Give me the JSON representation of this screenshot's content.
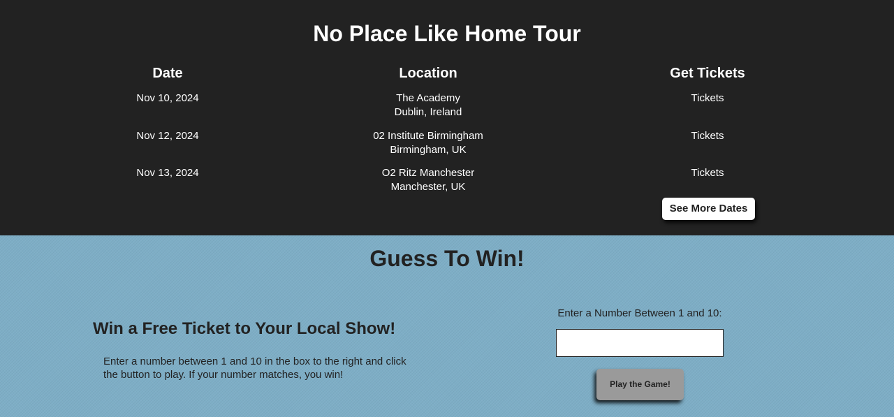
{
  "tour": {
    "title": "No Place Like Home Tour",
    "headers": {
      "date": "Date",
      "location": "Location",
      "tickets": "Get Tickets"
    },
    "rows": [
      {
        "date": "Nov 10, 2024",
        "venue": "The Academy",
        "city": "Dublin, Ireland",
        "ticket_label": "Tickets"
      },
      {
        "date": "Nov 12, 2024",
        "venue": "02 Institute Birmingham",
        "city": "Birmingham, UK",
        "ticket_label": "Tickets"
      },
      {
        "date": "Nov 13, 2024",
        "venue": "O2 Ritz Manchester",
        "city": "Manchester, UK",
        "ticket_label": "Tickets"
      }
    ],
    "see_more_label": "See More Dates",
    "colors": {
      "background": "#222222",
      "text": "#ffffff"
    }
  },
  "game": {
    "title": "Guess To Win!",
    "heading": "Win a Free Ticket to Your Local Show!",
    "description": "Enter a number between 1 and 10 in the box to the right and click the button to play. If your number matches, you win!",
    "input_label": "Enter a Number Between 1 and 10:",
    "input_value": "",
    "play_button_label": "Play the Game!",
    "colors": {
      "background": "#7eaec6",
      "button": "#9a9a9a",
      "text": "#222222"
    }
  }
}
